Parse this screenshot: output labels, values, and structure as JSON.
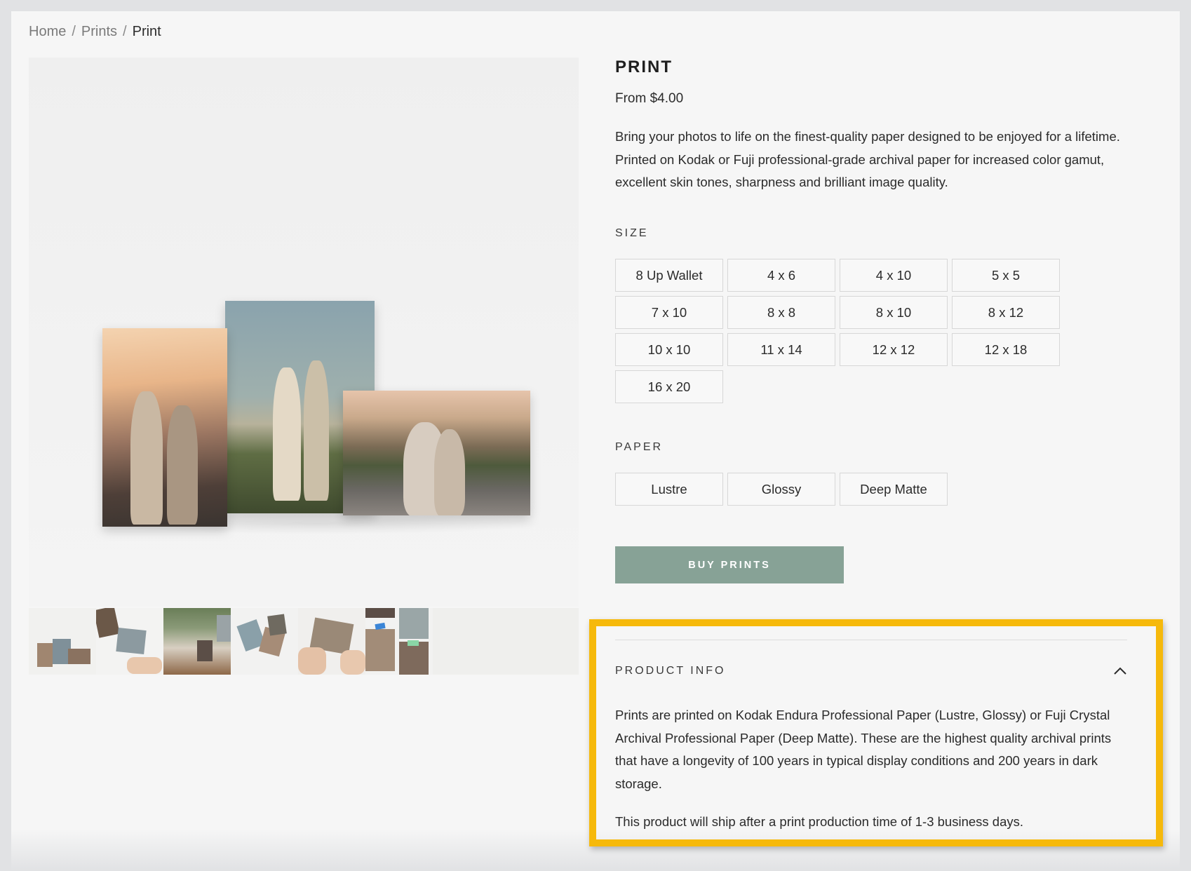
{
  "breadcrumb": {
    "home": "Home",
    "prints": "Prints",
    "current": "Print",
    "separator": "/"
  },
  "product": {
    "title": "PRINT",
    "price": "From $4.00",
    "description": "Bring your photos to life on the finest-quality paper designed to be enjoyed for a lifetime. Printed on Kodak or Fuji professional-grade archival paper for increased color gamut, excellent skin tones, sharpness and brilliant image quality."
  },
  "size": {
    "label": "SIZE",
    "options": [
      "8 Up Wallet",
      "4 x 6",
      "4 x 10",
      "5 x 5",
      "7 x 10",
      "8 x 8",
      "8 x 10",
      "8 x 12",
      "10 x 10",
      "11 x 14",
      "12 x 12",
      "12 x 18",
      "16 x 20"
    ]
  },
  "paper": {
    "label": "PAPER",
    "options": [
      "Lustre",
      "Glossy",
      "Deep Matte"
    ]
  },
  "buy_button": "BUY PRINTS",
  "product_info": {
    "title": "PRODUCT INFO",
    "expanded": true,
    "paragraphs": [
      "Prints are printed on Kodak Endura Professional Paper (Lustre, Glossy) or Fuji Crystal Archival Professional Paper (Deep Matte). These are the highest quality archival prints that have a longevity of 100 years in typical display conditions and 200 years in dark storage.",
      "This product will ship after a print production time of 1-3 business days."
    ]
  },
  "icons": {
    "collapse": "chevron-up-icon"
  },
  "colors": {
    "accent": "#87a296",
    "highlight": "#f6b90b",
    "page_bg": "#f6f6f6"
  }
}
